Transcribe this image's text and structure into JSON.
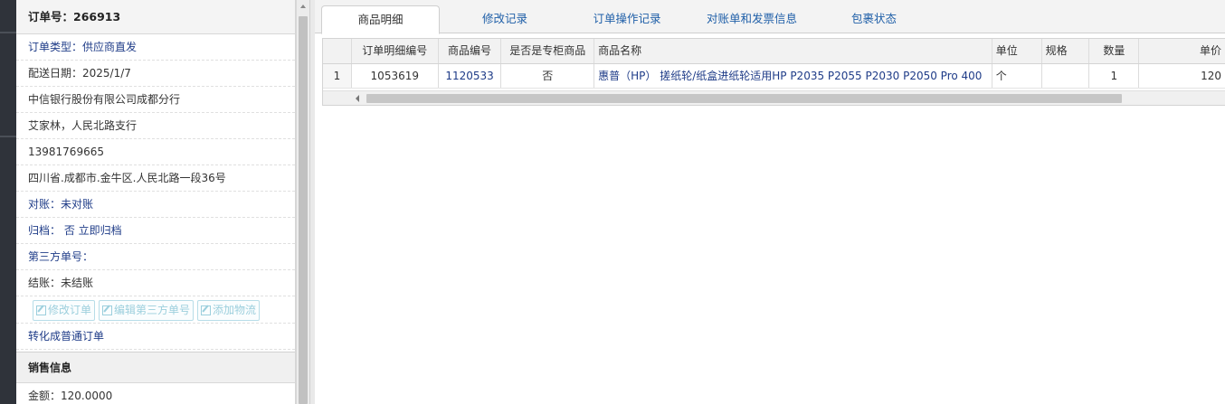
{
  "order": {
    "number_label": "订单号：266913",
    "type_label": "订单类型：供应商直发",
    "delivery_date": "配送日期：2025/1/7",
    "customer": "中信银行股份有限公司成都分行",
    "contact": "艾家林，人民北路支行",
    "phone": "13981769665",
    "address": "四川省.成都市.金牛区.人民北路一段36号",
    "reconcile": "对账：未对账",
    "archive": "归档：  否 立即归档",
    "third_party": "第三方单号：",
    "settlement": "结账：未结账",
    "buttons": {
      "edit_order": "修改订单",
      "edit_third_party": "编辑第三方单号",
      "add_logistics": "添加物流"
    },
    "convert_link": "转化成普通订单"
  },
  "sales": {
    "section_title": "销售信息",
    "amount": "金额：120.0000"
  },
  "tabs": [
    {
      "label": "商品明细"
    },
    {
      "label": "修改记录"
    },
    {
      "label": "订单操作记录"
    },
    {
      "label": "对账单和发票信息"
    },
    {
      "label": "包裹状态"
    }
  ],
  "table": {
    "headers": [
      "订单明细编号",
      "商品编号",
      "是否是专柜商品",
      "商品名称",
      "单位",
      "规格",
      "数量",
      "单价"
    ],
    "rows": [
      {
        "index": "1",
        "detail_no": "1053619",
        "sku": "1120533",
        "is_counter": "否",
        "name": "惠普（HP） 搓纸轮/纸盒进纸轮适用HP P2035 P2055 P2030 P2050 Pro 400",
        "unit": "个",
        "spec": "",
        "qty": "1",
        "price": "120"
      }
    ]
  }
}
